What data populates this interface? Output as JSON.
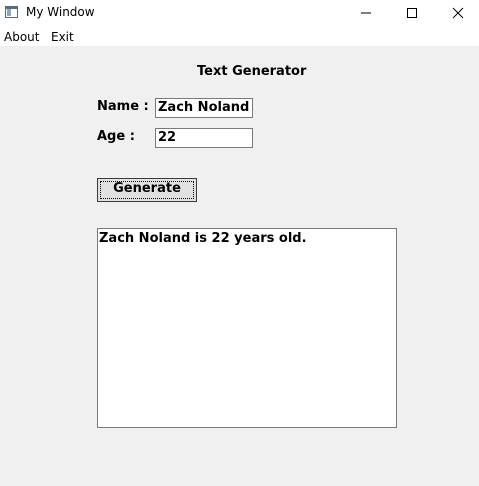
{
  "window": {
    "title": "My Window"
  },
  "menu": {
    "items": [
      "About",
      "Exit"
    ]
  },
  "form": {
    "heading": "Text Generator",
    "name_label": "Name :",
    "name_value": "Zach Noland",
    "age_label": "Age :",
    "age_value": "22",
    "generate_label": "Generate"
  },
  "output": {
    "text": "Zach Noland is 22 years old."
  },
  "icons": {
    "app": "app-window-icon",
    "minimize": "minimize-icon",
    "maximize": "maximize-icon",
    "close": "close-icon"
  }
}
